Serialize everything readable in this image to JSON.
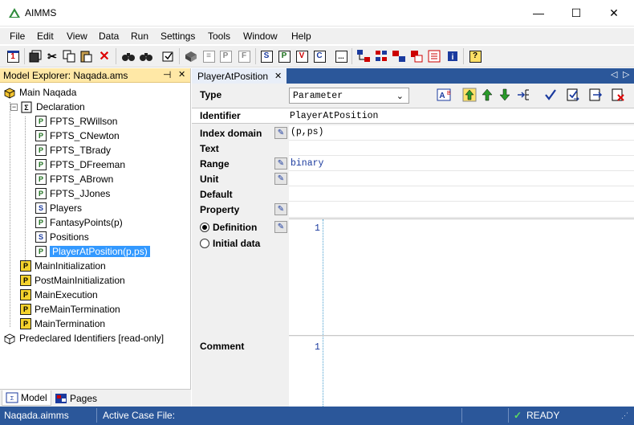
{
  "window": {
    "title": "AIMMS",
    "minimize_glyph": "—",
    "maximize_glyph": "☐",
    "close_glyph": "✕"
  },
  "menu": [
    "File",
    "Edit",
    "View",
    "Data",
    "Run",
    "Settings",
    "Tools",
    "Window",
    "Help"
  ],
  "toolbar": {
    "letter_buttons": [
      "S",
      "P",
      "V",
      "C"
    ],
    "more_glyph": "...",
    "help_glyph": "?"
  },
  "explorer": {
    "title": "Model Explorer: Naqada.ams",
    "pin_glyph": "⊣",
    "close_glyph": "✕",
    "tree": [
      {
        "label": "Main Naqada",
        "icon": "model-icon",
        "level": 0,
        "expander": ""
      },
      {
        "label": "Declaration",
        "icon": "declaration-icon",
        "level": 1,
        "expander": "−"
      },
      {
        "label": "FPTS_RWillson",
        "icon": "parameter-icon",
        "level": 2,
        "letter": "P"
      },
      {
        "label": "FPTS_CNewton",
        "icon": "parameter-icon",
        "level": 2,
        "letter": "P"
      },
      {
        "label": "FPTS_TBrady",
        "icon": "parameter-icon",
        "level": 2,
        "letter": "P"
      },
      {
        "label": "FPTS_DFreeman",
        "icon": "parameter-icon",
        "level": 2,
        "letter": "P"
      },
      {
        "label": "FPTS_ABrown",
        "icon": "parameter-icon",
        "level": 2,
        "letter": "P"
      },
      {
        "label": "FPTS_JJones",
        "icon": "parameter-icon",
        "level": 2,
        "letter": "P"
      },
      {
        "label": "Players",
        "icon": "set-icon",
        "level": 2,
        "letter": "S"
      },
      {
        "label": "FantasyPoints(p)",
        "icon": "parameter-icon",
        "level": 2,
        "letter": "P"
      },
      {
        "label": "Positions",
        "icon": "set-icon",
        "level": 2,
        "letter": "S"
      },
      {
        "label": "PlayerAtPosition(p,ps)",
        "icon": "parameter-icon",
        "level": 2,
        "letter": "P",
        "selected": true
      },
      {
        "label": "MainInitialization",
        "icon": "procedure-icon",
        "level": 1,
        "letter": "P"
      },
      {
        "label": "PostMainInitialization",
        "icon": "procedure-icon",
        "level": 1,
        "letter": "P"
      },
      {
        "label": "MainExecution",
        "icon": "procedure-icon",
        "level": 1,
        "letter": "P"
      },
      {
        "label": "PreMainTermination",
        "icon": "procedure-icon",
        "level": 1,
        "letter": "P"
      },
      {
        "label": "MainTermination",
        "icon": "procedure-icon",
        "level": 1,
        "letter": "P"
      },
      {
        "label": "Predeclared Identifiers [read-only]",
        "icon": "predeclared-icon",
        "level": 0,
        "expander": ""
      }
    ]
  },
  "bottom_tabs": [
    {
      "label": "Model",
      "icon": "model-tab-icon",
      "active": true
    },
    {
      "label": "Pages",
      "icon": "pages-tab-icon",
      "active": false
    }
  ],
  "doc_tab": {
    "label": "PlayerAtPosition",
    "close_glyph": "✕"
  },
  "doc_nav": {
    "left": "◁",
    "right": "▷"
  },
  "form": {
    "type_label": "Type",
    "type_value": "Parameter",
    "labels": {
      "identifier": "Identifier",
      "index_domain": "Index domain",
      "text": "Text",
      "range": "Range",
      "unit": "Unit",
      "default": "Default",
      "property": "Property",
      "definition": "Definition",
      "initial_data": "Initial data",
      "comment": "Comment"
    },
    "values": {
      "identifier": "PlayerAtPosition",
      "index_domain": "(p,ps)",
      "text": "",
      "range": "binary",
      "unit": "",
      "default": "",
      "property": ""
    },
    "definition_line": "1",
    "comment_line": "1"
  },
  "status": {
    "file": "Naqada.aimms",
    "case": "Active Case File:",
    "state": "READY"
  },
  "colors": {
    "status_bar": "#2b579a",
    "explorer_header": "#ffe8a6",
    "selection": "#3399ff"
  }
}
